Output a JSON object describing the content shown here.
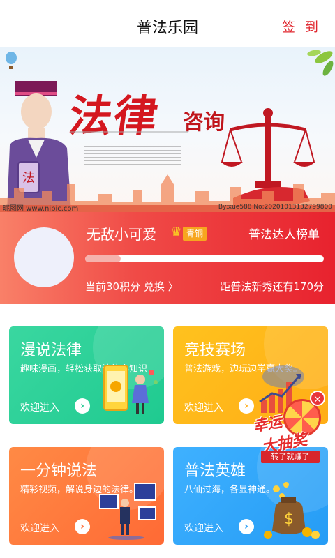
{
  "header": {
    "title": "普法乐园",
    "signin_label": "签 到"
  },
  "banner": {
    "headline": "法律",
    "headline_small": "咨询",
    "badge_char": "法",
    "watermark_left": "昵图网 www.nipic.com",
    "watermark_right": "By:xue588 No:20201013132799800"
  },
  "user": {
    "name": "无敌小可爱",
    "rank": "青铜",
    "leaderboard_label": "普法达人榜单",
    "points_text": "当前30积分 兑换 〉",
    "next_level_text": "距普法新秀还有170分",
    "progress_fraction": 0.15
  },
  "tiles": [
    {
      "title": "漫说法律",
      "subtitle": "趣味漫画，轻松获取法律小知识",
      "enter": "欢迎进入",
      "arrow": "›"
    },
    {
      "title": "竞技赛场",
      "subtitle": "普法游戏，边玩边学赢大奖。",
      "enter": "欢迎进入",
      "arrow": "›"
    },
    {
      "title": "一分钟说法",
      "subtitle": "精彩视频，解说身边的法律。",
      "enter": "欢迎进入",
      "arrow": "›"
    },
    {
      "title": "普法英雄",
      "subtitle": "八仙过海，各显神通。",
      "enter": "欢迎进入",
      "arrow": "›"
    }
  ],
  "lucky_draw": {
    "line1": "幸运",
    "line2": "大抽奖",
    "ribbon": "转了就赚了",
    "close": "×"
  }
}
